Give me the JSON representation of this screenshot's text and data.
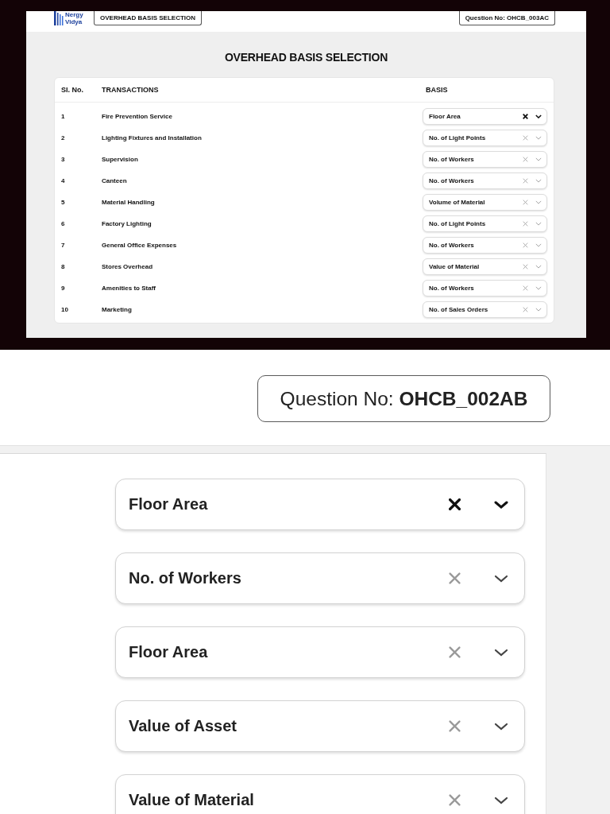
{
  "top_screenshot": {
    "logo": [
      "Nergy",
      "Vidya"
    ],
    "header_button": "OVERHEAD BASIS SELECTION",
    "question_no": "Question No: OHCB_003AC",
    "title": "OVERHEAD BASIS SELECTION",
    "table": {
      "columns": [
        "SI. No.",
        "TRANSACTIONS",
        "BASIS"
      ],
      "rows": [
        {
          "no": "1",
          "transaction": "Fire Prevention Service",
          "basis": "Floor Area",
          "active": true
        },
        {
          "no": "2",
          "transaction": "Lighting Fixtures and Installation",
          "basis": "No. of Light Points",
          "active": false
        },
        {
          "no": "3",
          "transaction": "Supervision",
          "basis": "No. of Workers",
          "active": false
        },
        {
          "no": "4",
          "transaction": "Canteen",
          "basis": "No. of Workers",
          "active": false
        },
        {
          "no": "5",
          "transaction": "Material Handling",
          "basis": "Volume of Material",
          "active": false
        },
        {
          "no": "6",
          "transaction": "Factory Lighting",
          "basis": "No. of Light Points",
          "active": false
        },
        {
          "no": "7",
          "transaction": "General Office Expenses",
          "basis": "No. of Workers",
          "active": false
        },
        {
          "no": "8",
          "transaction": "Stores Overhead",
          "basis": "Value of Material",
          "active": false
        },
        {
          "no": "9",
          "transaction": "Amenities to Staff",
          "basis": "No. of Workers",
          "active": false
        },
        {
          "no": "10",
          "transaction": "Marketing",
          "basis": "No. of Sales Orders",
          "active": false
        }
      ]
    }
  },
  "zoomed_view": {
    "question_no": "Question No: **OHCB_002AB**",
    "selects": [
      {
        "value": "Floor Area",
        "active": true
      },
      {
        "value": "No. of Workers",
        "active": false
      },
      {
        "value": "Floor Area",
        "active": false
      },
      {
        "value": "Value of Asset",
        "active": false
      },
      {
        "value": "Value of Material",
        "active": false
      }
    ]
  }
}
